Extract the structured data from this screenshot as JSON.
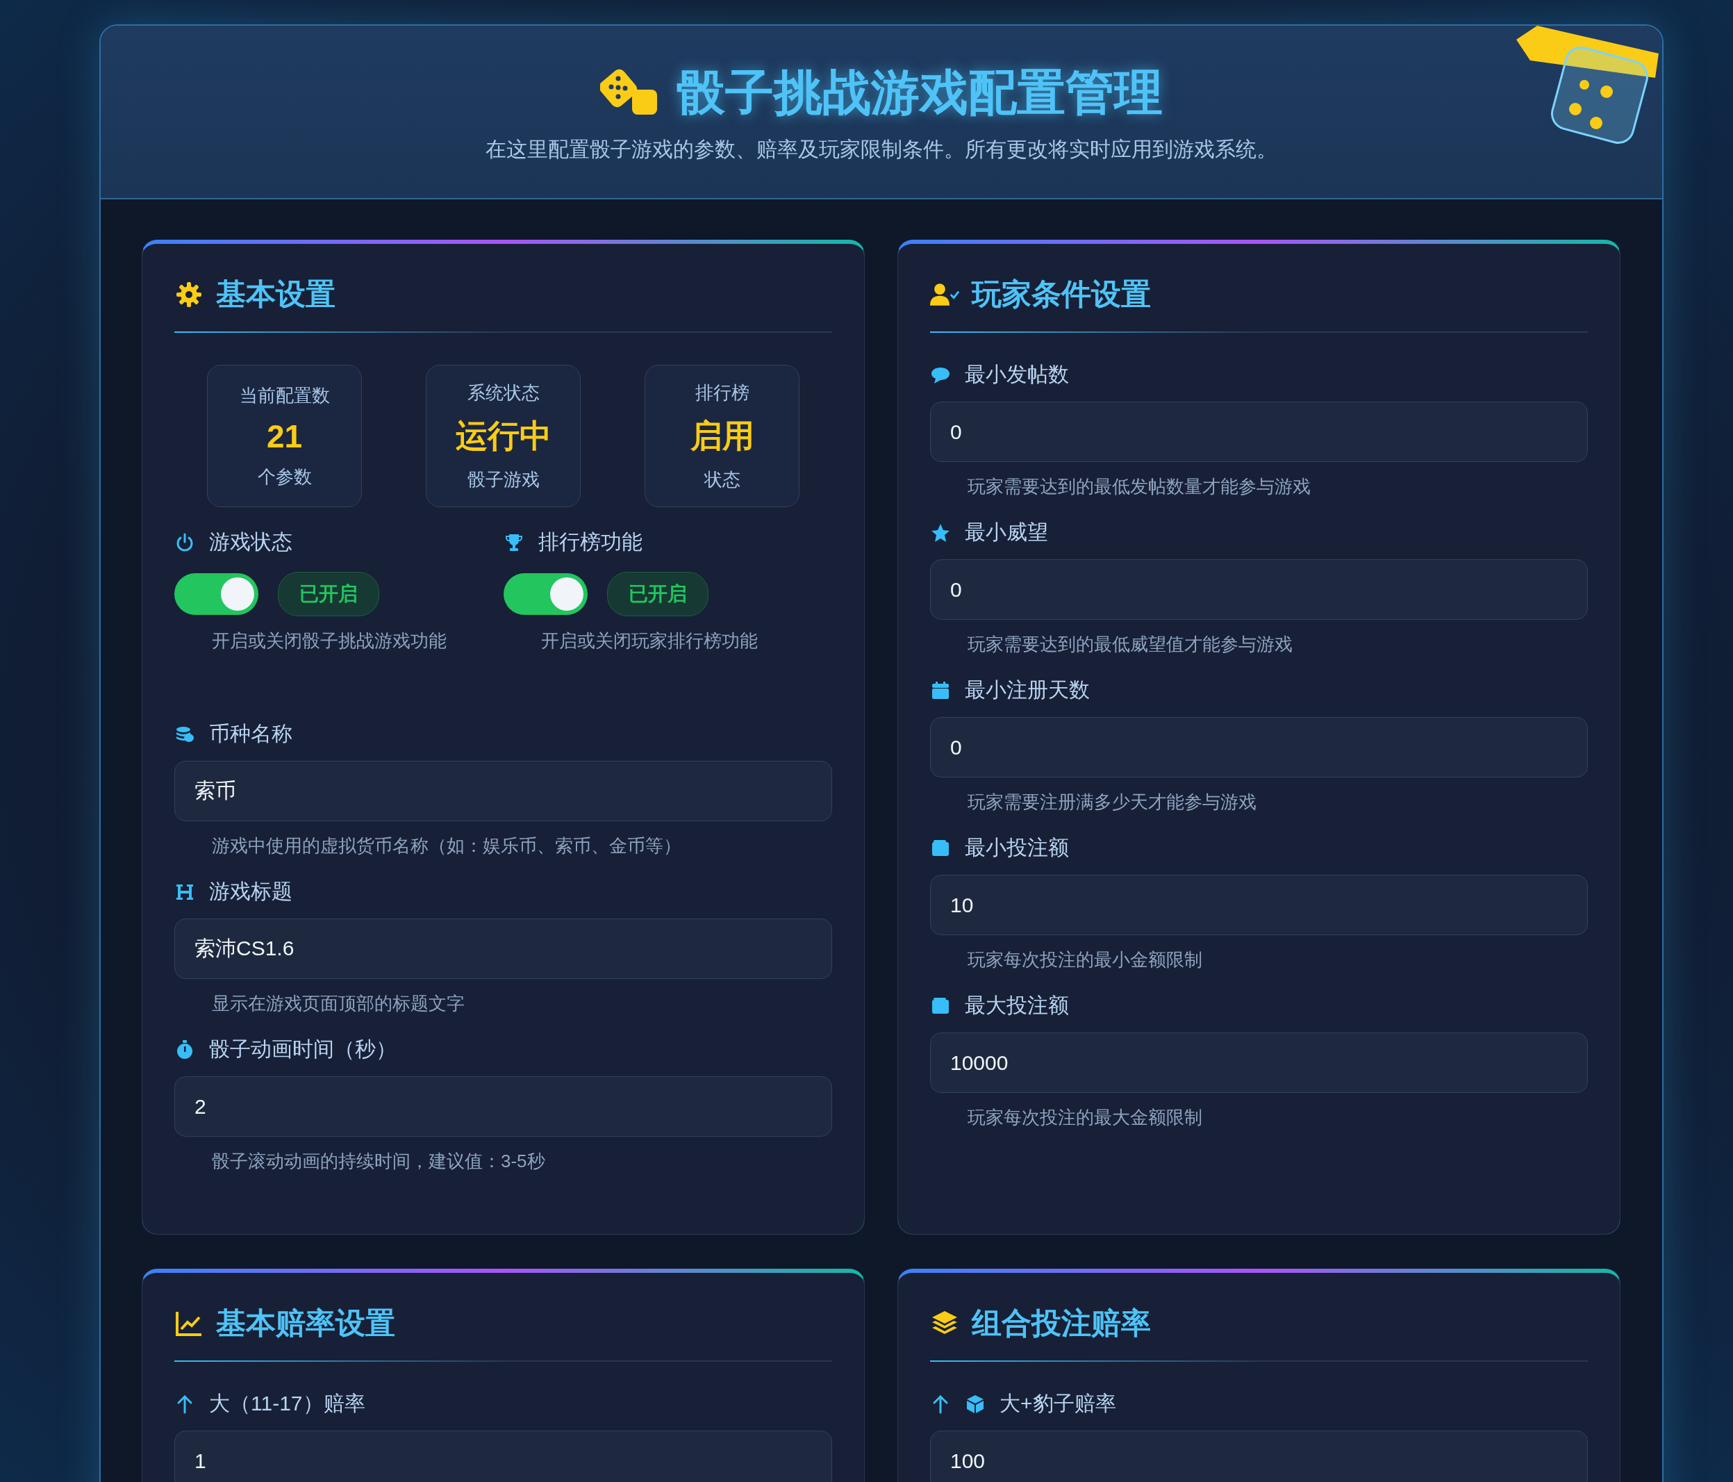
{
  "header": {
    "title": "骰子挑战游戏配置管理",
    "subtitle": "在这里配置骰子游戏的参数、赔率及玩家限制条件。所有更改将实时应用到游戏系统。"
  },
  "basic_settings": {
    "title": "基本设置",
    "stats": [
      {
        "label": "当前配置数",
        "value": "21",
        "unit": "个参数"
      },
      {
        "label": "系统状态",
        "value": "运行中",
        "unit": "骰子游戏"
      },
      {
        "label": "排行榜",
        "value": "启用",
        "unit": "状态"
      }
    ],
    "toggles": [
      {
        "label": "游戏状态",
        "on": true,
        "badge": "已开启",
        "help": "开启或关闭骰子挑战游戏功能"
      },
      {
        "label": "排行榜功能",
        "on": true,
        "badge": "已开启",
        "help": "开启或关闭玩家排行榜功能"
      }
    ],
    "fields": [
      {
        "label": "币种名称",
        "value": "索币",
        "help": "游戏中使用的虚拟货币名称（如：娱乐币、索币、金币等）"
      },
      {
        "label": "游戏标题",
        "value": "索沛CS1.6",
        "help": "显示在游戏页面顶部的标题文字"
      },
      {
        "label": "骰子动画时间（秒）",
        "value": "2",
        "help": "骰子滚动动画的持续时间，建议值：3-5秒"
      }
    ]
  },
  "player_conditions": {
    "title": "玩家条件设置",
    "fields": [
      {
        "label": "最小发帖数",
        "value": "0",
        "help": "玩家需要达到的最低发帖数量才能参与游戏"
      },
      {
        "label": "最小威望",
        "value": "0",
        "help": "玩家需要达到的最低威望值才能参与游戏"
      },
      {
        "label": "最小注册天数",
        "value": "0",
        "help": "玩家需要注册满多少天才能参与游戏"
      },
      {
        "label": "最小投注额",
        "value": "10",
        "help": "玩家每次投注的最小金额限制"
      },
      {
        "label": "最大投注额",
        "value": "10000",
        "help": "玩家每次投注的最大金额限制"
      }
    ]
  },
  "basic_odds": {
    "title": "基本赔率设置",
    "fields": [
      {
        "label": "大（11-17）赔率",
        "value": "1"
      }
    ]
  },
  "combo_odds": {
    "title": "组合投注赔率",
    "fields": [
      {
        "label": "大+豹子赔率",
        "value": "100"
      }
    ]
  }
}
